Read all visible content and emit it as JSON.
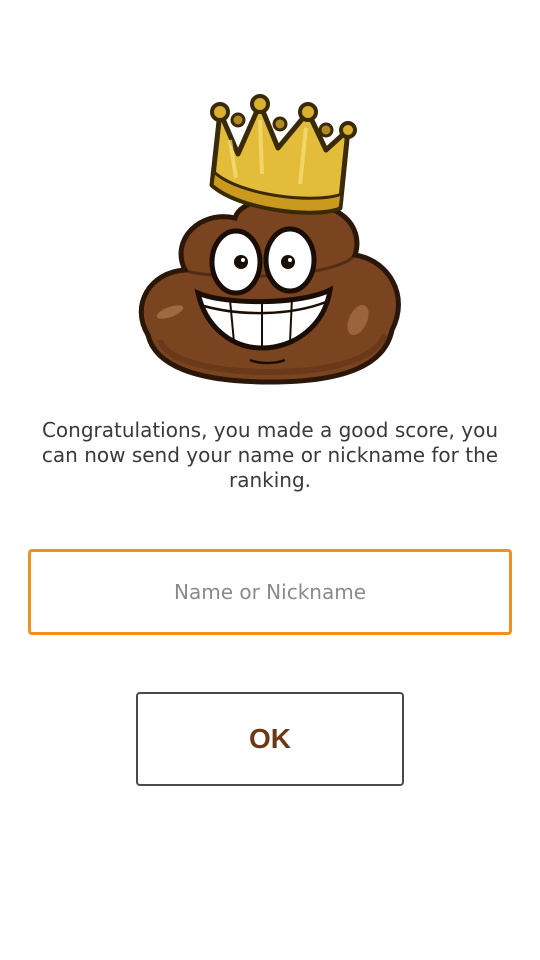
{
  "mascot": {
    "icon": "crowned-poop-emoji-icon"
  },
  "message": {
    "text": "Congratulations, you made a good score, you can now send your name or nickname for the ranking."
  },
  "name_field": {
    "placeholder": "Name or Nickname",
    "value": ""
  },
  "ok_button": {
    "label": "OK"
  },
  "colors": {
    "accent_border": "#f0901e",
    "button_text": "#6b3a12",
    "message_text": "#3a3a3a"
  }
}
